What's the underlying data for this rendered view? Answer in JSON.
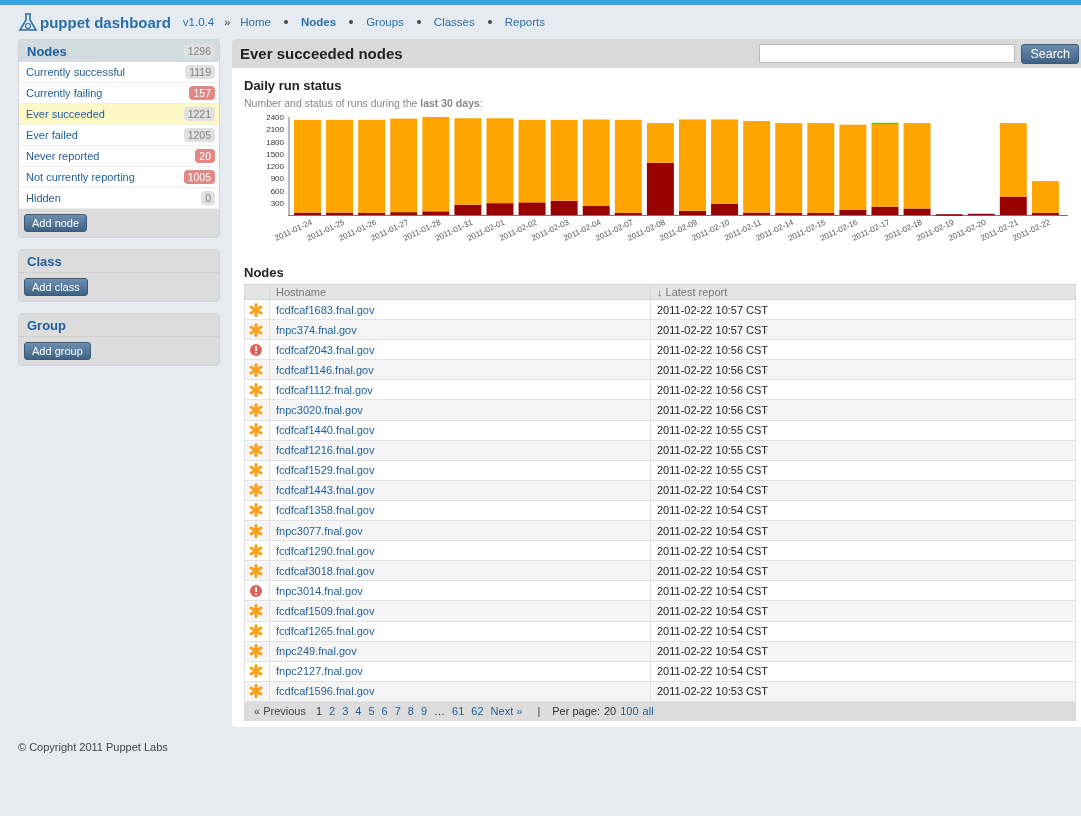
{
  "header": {
    "brand": "puppet dashboard",
    "version": "v1.0.4",
    "crumb_mark": "»",
    "nav": [
      {
        "label": "Home",
        "selected": false
      },
      {
        "label": "Nodes",
        "selected": true
      },
      {
        "label": "Groups",
        "selected": false
      },
      {
        "label": "Classes",
        "selected": false
      },
      {
        "label": "Reports",
        "selected": false
      }
    ]
  },
  "sidebar": {
    "nodes": {
      "title": "Nodes",
      "count": "1296",
      "items": [
        {
          "label": "Currently successful",
          "count": "1119",
          "alert": false,
          "selected": false
        },
        {
          "label": "Currently failing",
          "count": "157",
          "alert": true,
          "selected": false
        },
        {
          "label": "Ever succeeded",
          "count": "1221",
          "alert": false,
          "selected": true
        },
        {
          "label": "Ever failed",
          "count": "1205",
          "alert": false,
          "selected": false
        },
        {
          "label": "Never reported",
          "count": "20",
          "alert": true,
          "selected": false
        },
        {
          "label": "Not currently reporting",
          "count": "1005",
          "alert": true,
          "selected": false
        },
        {
          "label": "Hidden",
          "count": "0",
          "alert": false,
          "selected": false
        }
      ],
      "button": "Add node"
    },
    "class": {
      "title": "Class",
      "button": "Add class"
    },
    "group": {
      "title": "Group",
      "button": "Add group"
    }
  },
  "main": {
    "title": "Ever succeeded nodes",
    "search_button": "Search",
    "daily": {
      "title": "Daily run status",
      "note": "Number and status of runs during the **last 30 days**:",
      "chart_data": {
        "type": "bar",
        "stacked": true,
        "categories": [
          "2011-01-24",
          "2011-01-25",
          "2011-01-26",
          "2011-01-27",
          "2011-01-28",
          "2011-01-31",
          "2011-02-01",
          "2011-02-02",
          "2011-02-03",
          "2011-02-04",
          "2011-02-07",
          "2011-02-08",
          "2011-02-09",
          "2011-02-10",
          "2011-02-11",
          "2011-02-14",
          "2011-02-15",
          "2011-02-16",
          "2011-02-17",
          "2011-02-18",
          "2011-02-19",
          "2011-02-20",
          "2011-02-21",
          "2011-02-22"
        ],
        "series": [
          {
            "color": "#990000",
            "values": [
              60,
              60,
              50,
              70,
              90,
              250,
              290,
              310,
              350,
              220,
              50,
              1280,
              100,
              270,
              60,
              50,
              50,
              130,
              200,
              160,
              20,
              30,
              450,
              50
            ]
          },
          {
            "color": "#ffa500",
            "values": [
              2270,
              2270,
              2280,
              2290,
              2310,
              2120,
              2080,
              2020,
              1980,
              2120,
              2280,
              970,
              2240,
              2070,
              2240,
              2200,
              2200,
              2080,
              2030,
              2090,
              0,
              0,
              1800,
              780
            ]
          },
          {
            "color": "#66cc00",
            "values": [
              0,
              0,
              0,
              0,
              0,
              0,
              0,
              0,
              0,
              0,
              0,
              0,
              0,
              0,
              0,
              0,
              0,
              0,
              30,
              0,
              0,
              0,
              0,
              0
            ]
          }
        ],
        "ylim": [
          0,
          2400
        ],
        "yticks": [
          300,
          600,
          900,
          1200,
          1500,
          1800,
          2100,
          2400
        ]
      }
    },
    "nodes": {
      "title": "Nodes",
      "columns": [
        "Hostname",
        "↓ Latest report"
      ],
      "rows": [
        {
          "kind": "changed",
          "hostname": "fcdfcaf1683.fnal.gov",
          "latest": "2011-02-22 10:57 CST"
        },
        {
          "kind": "changed",
          "hostname": "fnpc374.fnal.gov",
          "latest": "2011-02-22 10:57 CST"
        },
        {
          "kind": "failed",
          "hostname": "fcdfcaf2043.fnal.gov",
          "latest": "2011-02-22 10:56 CST"
        },
        {
          "kind": "changed",
          "hostname": "fcdfcaf1146.fnal.gov",
          "latest": "2011-02-22 10:56 CST"
        },
        {
          "kind": "changed",
          "hostname": "fcdfcaf1112.fnal.gov",
          "latest": "2011-02-22 10:56 CST"
        },
        {
          "kind": "changed",
          "hostname": "fnpc3020.fnal.gov",
          "latest": "2011-02-22 10:56 CST"
        },
        {
          "kind": "changed",
          "hostname": "fcdfcaf1440.fnal.gov",
          "latest": "2011-02-22 10:55 CST"
        },
        {
          "kind": "changed",
          "hostname": "fcdfcaf1216.fnal.gov",
          "latest": "2011-02-22 10:55 CST"
        },
        {
          "kind": "changed",
          "hostname": "fcdfcaf1529.fnal.gov",
          "latest": "2011-02-22 10:55 CST"
        },
        {
          "kind": "changed",
          "hostname": "fcdfcaf1443.fnal.gov",
          "latest": "2011-02-22 10:54 CST"
        },
        {
          "kind": "changed",
          "hostname": "fcdfcaf1358.fnal.gov",
          "latest": "2011-02-22 10:54 CST"
        },
        {
          "kind": "changed",
          "hostname": "fnpc3077.fnal.gov",
          "latest": "2011-02-22 10:54 CST"
        },
        {
          "kind": "changed",
          "hostname": "fcdfcaf1290.fnal.gov",
          "latest": "2011-02-22 10:54 CST"
        },
        {
          "kind": "changed",
          "hostname": "fcdfcaf3018.fnal.gov",
          "latest": "2011-02-22 10:54 CST"
        },
        {
          "kind": "failed",
          "hostname": "fnpc3014.fnal.gov",
          "latest": "2011-02-22 10:54 CST"
        },
        {
          "kind": "changed",
          "hostname": "fcdfcaf1509.fnal.gov",
          "latest": "2011-02-22 10:54 CST"
        },
        {
          "kind": "changed",
          "hostname": "fcdfcaf1265.fnal.gov",
          "latest": "2011-02-22 10:54 CST"
        },
        {
          "kind": "changed",
          "hostname": "fnpc249.fnal.gov",
          "latest": "2011-02-22 10:54 CST"
        },
        {
          "kind": "changed",
          "hostname": "fnpc2127.fnal.gov",
          "latest": "2011-02-22 10:54 CST"
        },
        {
          "kind": "changed",
          "hostname": "fcdfcaf1596.fnal.gov",
          "latest": "2011-02-22 10:53 CST"
        }
      ],
      "pagination": {
        "previous": "« Previous",
        "pages": [
          {
            "label": "1",
            "selected": true
          },
          {
            "label": "2",
            "selected": false
          },
          {
            "label": "3",
            "selected": false
          },
          {
            "label": "4",
            "selected": false
          },
          {
            "label": "5",
            "selected": false
          },
          {
            "label": "6",
            "selected": false
          },
          {
            "label": "7",
            "selected": false
          },
          {
            "label": "8",
            "selected": false
          },
          {
            "label": "9",
            "selected": false
          }
        ],
        "gap": "…",
        "last_pages": [
          {
            "label": "61",
            "selected": false
          },
          {
            "label": "62",
            "selected": false
          }
        ],
        "next": "Next »",
        "divider": "|",
        "per_page_label": "Per page:",
        "per_page": [
          {
            "label": "20",
            "selected": true
          },
          {
            "label": "100",
            "selected": false
          },
          {
            "label": "all",
            "selected": false
          }
        ]
      }
    }
  },
  "footer": "© Copyright 2011 Puppet Labs"
}
